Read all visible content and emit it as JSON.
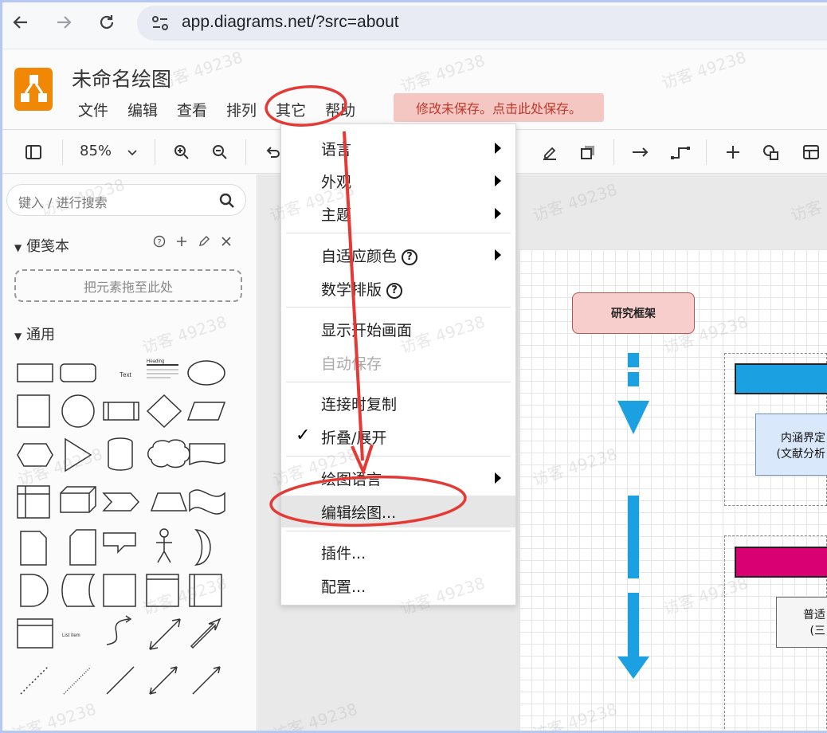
{
  "browser": {
    "url": "app.diagrams.net/?src=about"
  },
  "app": {
    "title": "未命名绘图",
    "menus": [
      "文件",
      "编辑",
      "查看",
      "排列",
      "其它",
      "帮助"
    ],
    "unsaved_notice": "修改未保存。点击此处保存。",
    "brand_color": "#f08705"
  },
  "toolbar": {
    "zoom": "85%"
  },
  "sidebar": {
    "search_placeholder": "键入 / 进行搜索",
    "scratchpad_title": "便笺本",
    "dropzone_text": "把元素拖至此处",
    "general_title": "通用",
    "shape_labels": {
      "text": "Text",
      "heading": "Heading",
      "list_item": "List Item"
    }
  },
  "dropdown": {
    "items": [
      {
        "label": "语言",
        "submenu": true
      },
      {
        "label": "外观",
        "submenu": true
      },
      {
        "label": "主题",
        "submenu": true
      },
      {
        "label": "自适应颜色",
        "submenu": true,
        "help": true
      },
      {
        "label": "数学排版",
        "help": true
      },
      {
        "label": "显示开始画面"
      },
      {
        "label": "自动保存",
        "disabled": true
      },
      {
        "label": "连接时复制"
      },
      {
        "label": "折叠/展开",
        "checked": true
      },
      {
        "label": "绘图语言",
        "submenu": true
      },
      {
        "label": "编辑绘图...",
        "highlighted": true
      },
      {
        "label": "插件..."
      },
      {
        "label": "配置..."
      }
    ]
  },
  "diagram": {
    "research_box": "研究框架",
    "blue_box_lines": [
      "内涵界定",
      "(文献分析"
    ],
    "white_box_lines": [
      "普适",
      "(三"
    ],
    "colors": {
      "research_fill": "#f8cecc",
      "blue_bar": "#1ba1e2",
      "pink_bar": "#d80073",
      "arrow": "#1ba1e2"
    }
  },
  "watermark": "访客 49238",
  "annotation_color": "#e53935"
}
